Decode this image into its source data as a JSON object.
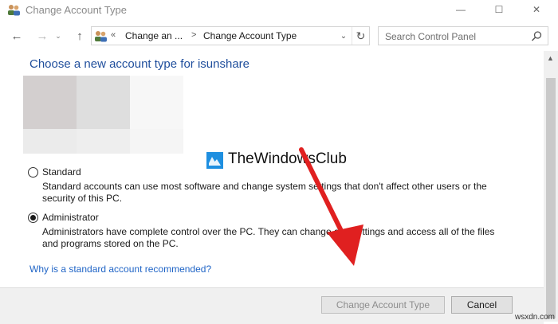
{
  "window": {
    "title": "Change Account Type",
    "minimize_glyph": "—",
    "maximize_glyph": "☐",
    "close_glyph": "✕"
  },
  "nav": {
    "back_glyph": "←",
    "forward_glyph": "→",
    "recent_glyph": "⌄",
    "up_glyph": "↑",
    "address": {
      "overflow_glyph": "«",
      "crumbs": [
        "Change an ...",
        "Change Account Type"
      ],
      "separator": ">",
      "dropdown_glyph": "⌄",
      "refresh_glyph": "↻"
    },
    "search": {
      "placeholder": "Search Control Panel"
    }
  },
  "main": {
    "heading": "Choose a new account type for isunshare",
    "options": [
      {
        "label": "Standard",
        "checked": false,
        "description_lines": [
          "Standard accounts can use most software and change system settings that don't affect other users or the",
          "security of this PC."
        ]
      },
      {
        "label": "Administrator",
        "checked": true,
        "description_lines": [
          "Administrators have complete control over the PC. They can change any settings and access all of the files",
          "and programs stored on the PC."
        ]
      }
    ],
    "why_link": "Why is a standard account recommended?"
  },
  "footer": {
    "change_button": "Change Account Type",
    "cancel_button": "Cancel"
  },
  "watermark": {
    "text": "TheWindowsClub",
    "logo_color": "#1e8fe0"
  },
  "site_watermark": "wsxdn.com",
  "colors": {
    "heading": "#1f4e9c",
    "link": "#1f64c6",
    "annotation_arrow": "#e02020"
  }
}
